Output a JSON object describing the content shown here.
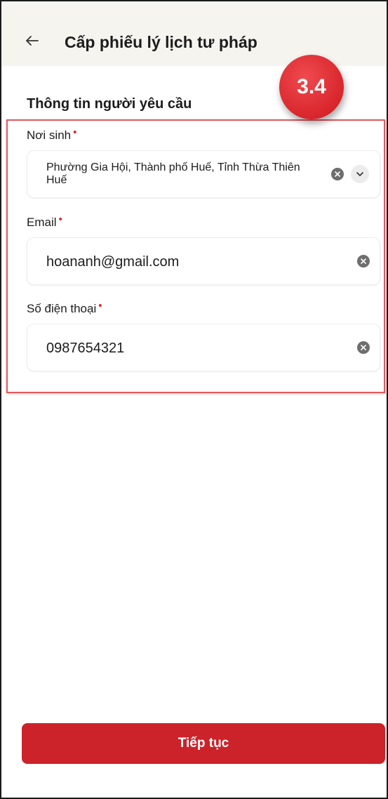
{
  "header": {
    "title": "Cấp phiếu lý lịch tư pháp",
    "back_icon": "arrow-left-icon"
  },
  "section": {
    "title": "Thông tin người yêu cầu"
  },
  "step_badge": {
    "text": "3.4",
    "color": "#d8262c"
  },
  "fields": {
    "birthplace": {
      "label": "Nơi sinh",
      "required_mark": "•",
      "value": "Phường Gia Hội, Thành phố Huế, Tỉnh Thừa Thiên Huế"
    },
    "email": {
      "label": "Email",
      "required_mark": "•",
      "value": "hoananh@gmail.com"
    },
    "phone": {
      "label": "Số điện thoại",
      "required_mark": "•",
      "value": "0987654321"
    }
  },
  "actions": {
    "continue_label": "Tiếp tục"
  },
  "colors": {
    "accent": "#cc2229",
    "header_bg": "#f6f4ef",
    "highlight_border": "#e05a5e"
  }
}
